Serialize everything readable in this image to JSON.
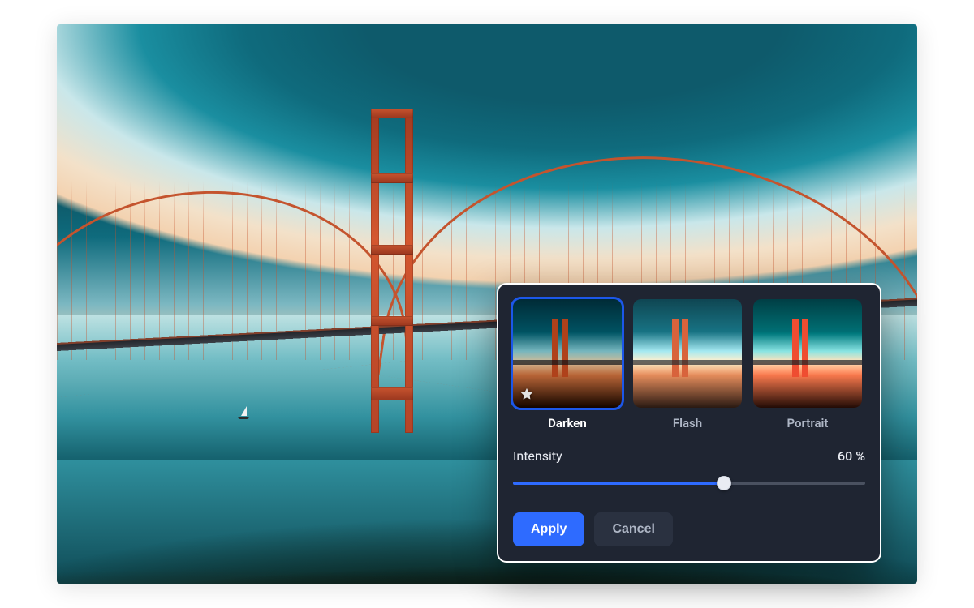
{
  "filters": [
    {
      "key": "darken",
      "label": "Darken",
      "mode_class": "mode-darken",
      "favorite": true,
      "selected": true
    },
    {
      "key": "flash",
      "label": "Flash",
      "mode_class": "mode-flash",
      "favorite": false,
      "selected": false
    },
    {
      "key": "portrait",
      "label": "Portrait",
      "mode_class": "mode-portrait",
      "favorite": false,
      "selected": false
    }
  ],
  "slider": {
    "label": "Intensity",
    "value_percent": 60,
    "value_display": "60 %"
  },
  "buttons": {
    "apply": "Apply",
    "cancel": "Cancel"
  },
  "colors": {
    "accent": "#2e6bff",
    "panel_bg": "#1f2532"
  }
}
